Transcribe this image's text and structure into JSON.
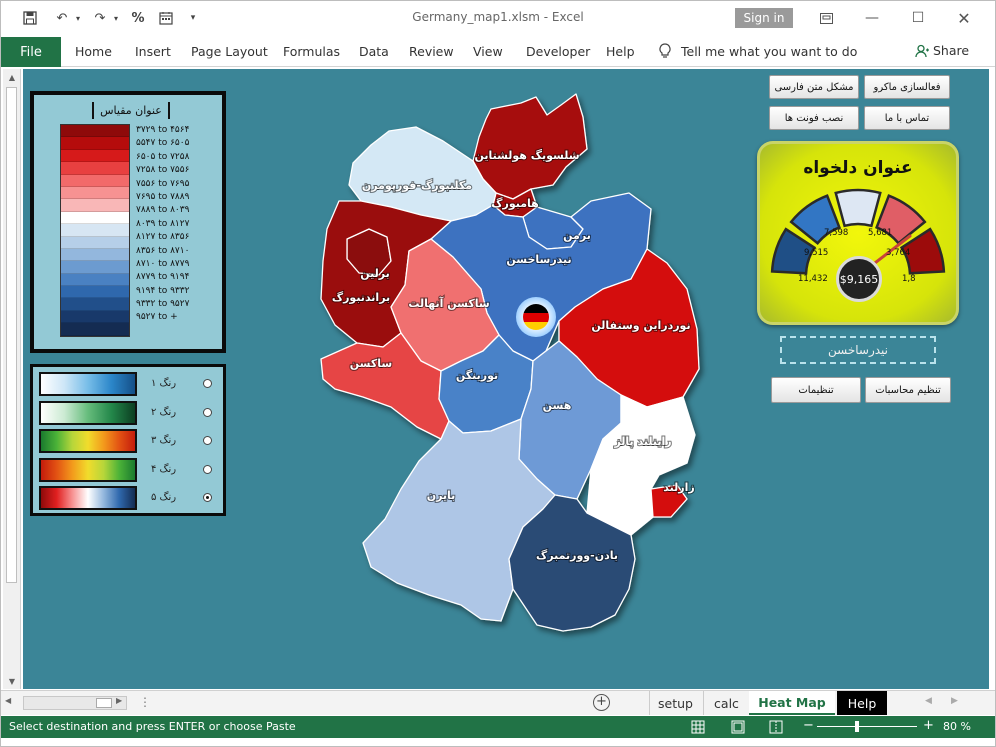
{
  "window": {
    "title": "Germany_map1.xlsm  -  Excel",
    "signin_label": "Sign in"
  },
  "quick_access": [
    "save-icon",
    "undo-icon",
    "redo-icon",
    "percent-icon",
    "calendar-icon",
    "customize-icon"
  ],
  "ribbon": {
    "file_label": "File",
    "tabs": [
      "Home",
      "Insert",
      "Page Layout",
      "Formulas",
      "Data",
      "Review",
      "View",
      "Developer",
      "Help"
    ],
    "tell_me": "Tell me what you want to do",
    "share_label": "Share"
  },
  "legend": {
    "title": "عنوان مقیاس",
    "colors": [
      "#8e0a0a",
      "#b50c0c",
      "#d61a1a",
      "#e84040",
      "#f26a6a",
      "#f79292",
      "#f9b7b7",
      "#ffffff",
      "#d7e6f3",
      "#b6cfe8",
      "#93b7dd",
      "#6c9bd0",
      "#4a81c2",
      "#2f68ad",
      "#214f8a",
      "#18396a",
      "#142c52"
    ],
    "labels": [
      "۳۷۲۹ to ۴۵۶۴",
      "۵۵۴۷ to ۶۵۰۵",
      "۶۵۰۵ to ۷۲۵۸",
      "۷۲۵۸ to ۷۵۵۶",
      "۷۵۵۶ to ۷۶۹۵",
      "۷۶۹۵ to ۷۸۸۹",
      "۷۸۸۹ to ۸۰۳۹",
      "۸۰۳۹ to ۸۱۲۷",
      "۸۱۲۷ to ۸۳۵۶",
      "۸۳۵۶ to ۸۷۱۰",
      "۸۷۱۰ to ۸۷۷۹",
      "۸۷۷۹ to ۹۱۹۴",
      "۹۱۹۴ to ۹۳۳۲",
      "۹۳۳۲ to ۹۵۲۷",
      "۹۵۲۷ to +"
    ]
  },
  "schemes": {
    "items": [
      {
        "label": "رنگ ۱",
        "gradient": "linear-gradient(90deg,#ffffff,#cde6f7,#77bde8,#2b86c9,#154f87)"
      },
      {
        "label": "رنگ ۲",
        "gradient": "linear-gradient(90deg,#ffffff,#cbead2,#66bc7c,#23874a,#0c3e21)"
      },
      {
        "label": "رنگ ۳",
        "gradient": "linear-gradient(90deg,#1a7a2e,#4bb238,#b7d63a,#f1dc2c,#f39a1c,#e25213,#c41c0c)"
      },
      {
        "label": "رنگ ۴",
        "gradient": "linear-gradient(90deg,#c41c0c,#e25213,#f39a1c,#f1dc2c,#b7d63a,#4bb238,#1a7a2e)"
      },
      {
        "label": "رنگ ۵",
        "gradient": "linear-gradient(90deg,#8e0a0a,#e02020,#f79292,#ffffff,#93b7dd,#2f68ad,#142c52)"
      }
    ],
    "selected_index": 4
  },
  "map": {
    "regions": [
      {
        "name": "شلسویگ هولشتاین",
        "color": "#a60c0c"
      },
      {
        "name": "هامبورگ",
        "color": "#a60c0c"
      },
      {
        "name": "مکلنبورگ-فورپومرن",
        "color": "#d4e8f5"
      },
      {
        "name": "برمن",
        "color": "#3c72c0"
      },
      {
        "name": "نیدرساخسن",
        "color": "#3c72c0"
      },
      {
        "name": "برلین",
        "color": "#8b0a0a"
      },
      {
        "name": "براندنبورگ",
        "color": "#9a0b0b"
      },
      {
        "name": "ساکسن آنهالت",
        "color": "#f07070"
      },
      {
        "name": "نوردراین وستفالن",
        "color": "#d40c0c"
      },
      {
        "name": "ساکسن",
        "color": "#e64545"
      },
      {
        "name": "تورینگن",
        "color": "#4a82c8"
      },
      {
        "name": "هسن",
        "color": "#6e9ad6"
      },
      {
        "name": "راینلند پالز",
        "color": "#ffffff"
      },
      {
        "name": "زارلند",
        "color": "#d40c0c"
      },
      {
        "name": "بایرن",
        "color": "#aec6e6"
      },
      {
        "name": "بادن-وورتمبرگ",
        "color": "#2a4b75"
      }
    ]
  },
  "buttons": {
    "activate_macro": "فعالسازی ماکرو",
    "persian_text_issue": "مشکل متن فارسی",
    "contact_us": "تماس با ما",
    "install_font": "نصب فونت ها",
    "calc_settings": "تنظیم محاسبات",
    "settings": "تنظیمات"
  },
  "gauge": {
    "title": "عنوان دلخواه",
    "center_value": "$9,165",
    "ticks": [
      "11,432",
      "9,515",
      "7,598",
      "5,681",
      "3,764",
      "1,8"
    ],
    "segment_colors": [
      "#1f4f86",
      "#3276c4",
      "#dde7f3",
      "#e05e66",
      "#9c0b0b"
    ]
  },
  "selected_region": "نیدرساخسن",
  "sheet_tabs": [
    {
      "label": "setup",
      "active": false
    },
    {
      "label": "calc",
      "active": false
    },
    {
      "label": "Heat Map",
      "active": true
    },
    {
      "label": "Help",
      "active": false
    }
  ],
  "status": {
    "message": "Select destination and press ENTER or choose Paste",
    "zoom": "80 %"
  }
}
